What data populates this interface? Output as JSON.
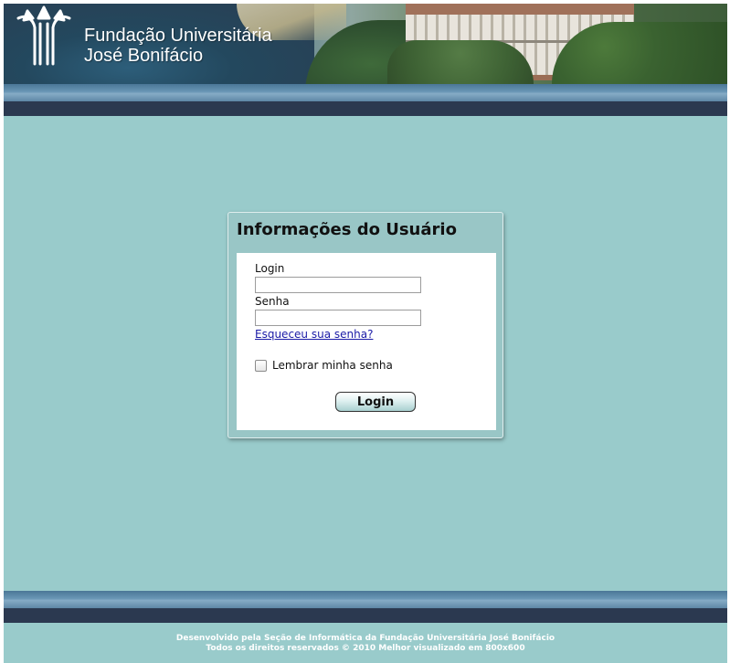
{
  "header": {
    "brand_line1": "Fundação Universitária",
    "brand_line2": "José Bonifácio"
  },
  "login_panel": {
    "title": "Informações do Usuário",
    "login_label": "Login",
    "login_value": "",
    "password_label": "Senha",
    "password_value": "",
    "forgot_link": "Esqueceu sua senha?",
    "remember_label": "Lembrar minha senha",
    "remember_checked": false,
    "submit_label": "Login"
  },
  "footer": {
    "line1": "Desenvolvido pela Seção de Informática da Fundação Universitária José Bonifácio",
    "line2": "Todos os direitos reservados © 2010 Melhor visualizado em 800x600"
  },
  "colors": {
    "page_background": "#99cbcb",
    "bar_dark": "#2b3950",
    "bar_light": "#6a97b6",
    "link": "#1a1aa6"
  },
  "icons": {
    "logo": "fujb-logo-icon"
  }
}
